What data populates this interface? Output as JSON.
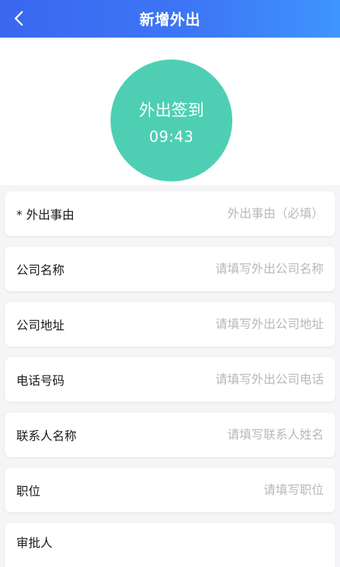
{
  "header": {
    "title": "新增外出",
    "back_icon": "chevron-left-icon"
  },
  "checkin": {
    "label": "外出签到",
    "time": "09:43",
    "color": "#4ecfb3"
  },
  "form": {
    "reason": {
      "label": "* 外出事由",
      "placeholder": "外出事由（必填）"
    },
    "company_name": {
      "label": "公司名称",
      "placeholder": "请填写外出公司名称"
    },
    "company_address": {
      "label": "公司地址",
      "placeholder": "请填写外出公司地址"
    },
    "phone": {
      "label": "电话号码",
      "placeholder": "请填写外出公司电话"
    },
    "contact_name": {
      "label": "联系人名称",
      "placeholder": "请填写联系人姓名"
    },
    "position": {
      "label": "职位",
      "placeholder": "请填写职位"
    },
    "approver": {
      "label": "审批人"
    }
  },
  "colors": {
    "header_start": "#3a67f0",
    "header_end": "#3f95ff",
    "placeholder": "#b8b8bc"
  }
}
